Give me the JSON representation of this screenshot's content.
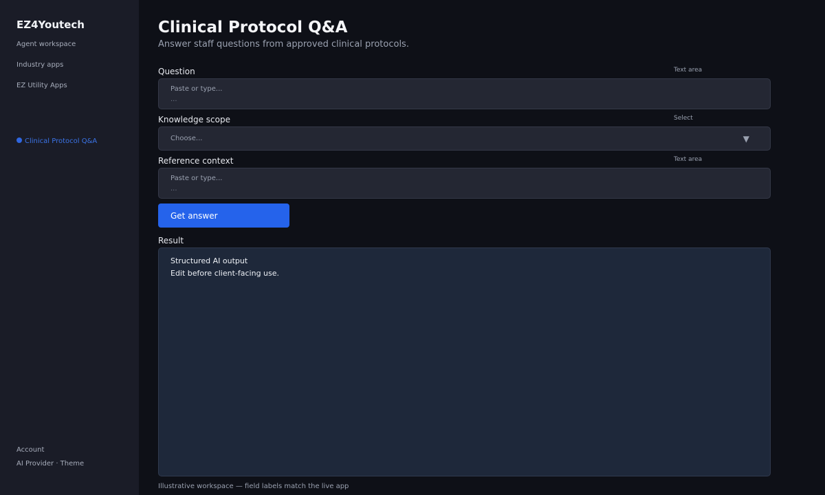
{
  "sidebar": {
    "brand": "EZ4Youtech",
    "nav": [
      "Agent workspace",
      "Industry apps",
      "EZ Utility Apps"
    ],
    "active_item": "Clinical Protocol Q&A",
    "footer": [
      "Account",
      "AI Provider · Theme"
    ]
  },
  "header": {
    "title": "Clinical Protocol Q&A",
    "subtitle": "Answer staff questions from approved clinical protocols."
  },
  "form": {
    "question": {
      "label": "Question",
      "kind": "Text area",
      "placeholder": "Paste or type...",
      "placeholder_line2": "..."
    },
    "scope": {
      "label": "Knowledge scope",
      "kind": "Select",
      "placeholder": "Choose...",
      "chevron": "▼"
    },
    "context": {
      "label": "Reference context",
      "kind": "Text area",
      "placeholder": "Paste or type...",
      "placeholder_line2": "..."
    },
    "submit_label": "Get answer"
  },
  "result": {
    "label": "Result",
    "lines": [
      "Structured AI output",
      "Edit before client-facing use."
    ]
  },
  "footnote": "Illustrative workspace — field labels match the live app",
  "colors": {
    "accent": "#2563eb",
    "sidebar_bg": "#1a1c27",
    "page_bg": "#0e1017",
    "result_bg": "#1e283a"
  }
}
